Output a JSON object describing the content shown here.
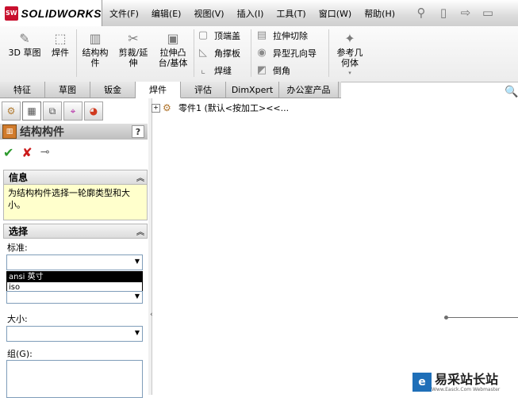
{
  "app": {
    "logo_badge": "SW",
    "logo_text": "SOLIDWORKS"
  },
  "menu": [
    "文件(F)",
    "编辑(E)",
    "视图(V)",
    "插入(I)",
    "工具(T)",
    "窗口(W)",
    "帮助(H)"
  ],
  "toolbar_icons": [
    "pin-icon",
    "new-document-icon",
    "open-icon",
    "save-icon"
  ],
  "ribbon": {
    "big_buttons": [
      {
        "label": "3D 草图",
        "icon": "3d-sketch-icon",
        "glyph": "✎"
      },
      {
        "label": "焊件",
        "icon": "weldment-icon",
        "glyph": "⬚"
      },
      {
        "label": "结构构\n件",
        "icon": "structural-member-icon",
        "glyph": "▥"
      },
      {
        "label": "剪裁/延\n伸",
        "icon": "trim-extend-icon",
        "glyph": "✂"
      },
      {
        "label": "拉伸凸\n台/基体",
        "icon": "extruded-boss-icon",
        "glyph": "▣"
      }
    ],
    "small_col1": [
      {
        "label": "顶端盖",
        "icon": "end-cap-icon",
        "glyph": "▢"
      },
      {
        "label": "角撑板",
        "icon": "gusset-icon",
        "glyph": "◺"
      },
      {
        "label": "焊缝",
        "icon": "fillet-bead-icon",
        "glyph": "⌞"
      }
    ],
    "small_col2": [
      {
        "label": "拉伸切除",
        "icon": "extruded-cut-icon",
        "glyph": "▤"
      },
      {
        "label": "异型孔向导",
        "icon": "hole-wizard-icon",
        "glyph": "◉"
      },
      {
        "label": "倒角",
        "icon": "chamfer-icon",
        "glyph": "◩"
      }
    ],
    "ref_geometry": {
      "label": "参考几\n何体",
      "icon": "reference-geometry-icon",
      "glyph": "✦"
    }
  },
  "tabs": [
    {
      "label": "特征",
      "active": false
    },
    {
      "label": "草图",
      "active": false
    },
    {
      "label": "钣金",
      "active": false
    },
    {
      "label": "焊件",
      "active": true
    },
    {
      "label": "评估",
      "active": false
    },
    {
      "label": "DimXpert",
      "active": false
    },
    {
      "label": "办公室产品",
      "active": false
    }
  ],
  "pm_tabs": [
    "feature-manager-icon",
    "property-manager-icon",
    "configuration-manager-icon",
    "dimxpert-manager-icon",
    "display-manager-icon"
  ],
  "property_manager": {
    "title": "结构构件",
    "help": "?",
    "info": {
      "header": "信息",
      "text": "为结构构件选择一轮廓类型和大小。"
    },
    "selection": {
      "header": "选择",
      "standard_label": "标准:",
      "standard_value": "",
      "type_options": [
        "ansi 英寸",
        "iso"
      ],
      "type_selected_index": 0,
      "size_label": "大小:",
      "size_value": "",
      "group_label": "组(G):"
    }
  },
  "tree": {
    "root_label": "零件1 (默认<按加工><<..."
  },
  "watermark": {
    "text": "易采站长站",
    "sub": "Www.Easck.Com Webmaster"
  }
}
